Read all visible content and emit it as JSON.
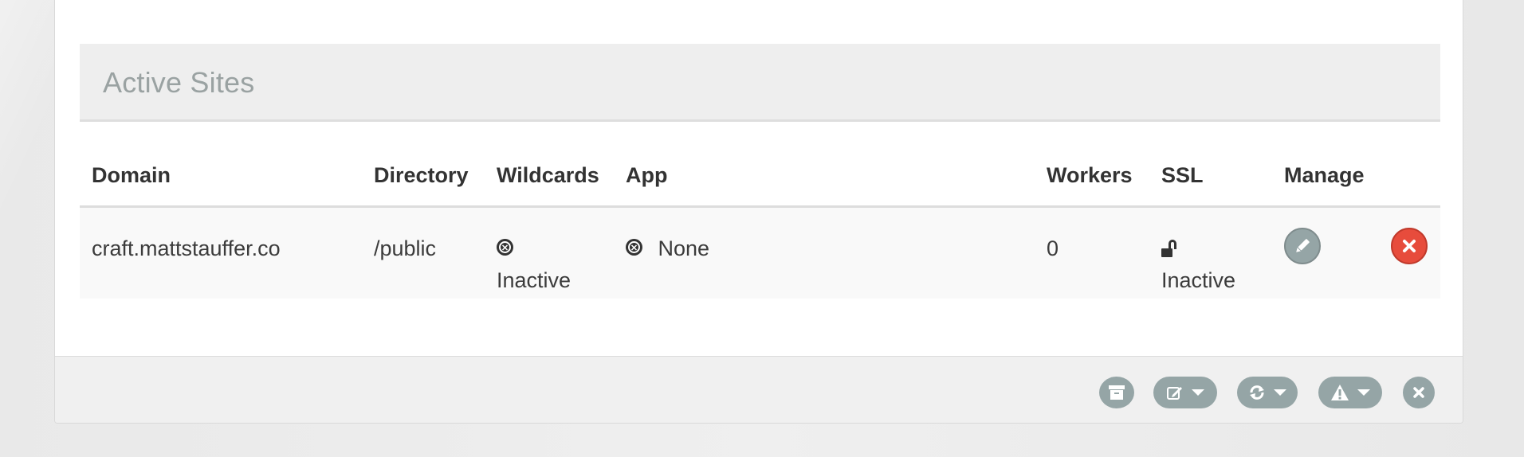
{
  "panel": {
    "heading": "Active Sites"
  },
  "table": {
    "columns": [
      "Domain",
      "Directory",
      "Wildcards",
      "App",
      "Workers",
      "SSL",
      "Manage"
    ],
    "rows": [
      {
        "domain": "craft.mattstauffer.co",
        "directory": "/public",
        "wildcards": "Inactive",
        "app": "None",
        "workers": "0",
        "ssl": "Inactive"
      }
    ]
  },
  "icons": {
    "wildcards": "circle-x-icon",
    "app": "circle-x-icon",
    "ssl": "unlock-icon",
    "edit": "pencil-icon",
    "delete": "close-icon",
    "archive": "archive-icon",
    "edit_dropdown": "edit-icon",
    "refresh_dropdown": "refresh-icon",
    "warning_dropdown": "warning-icon",
    "dismiss": "close-icon"
  },
  "colors": {
    "accent_gray": "#95a5a6",
    "danger_red": "#e74c3c",
    "heading_text": "#9aa2a2"
  }
}
